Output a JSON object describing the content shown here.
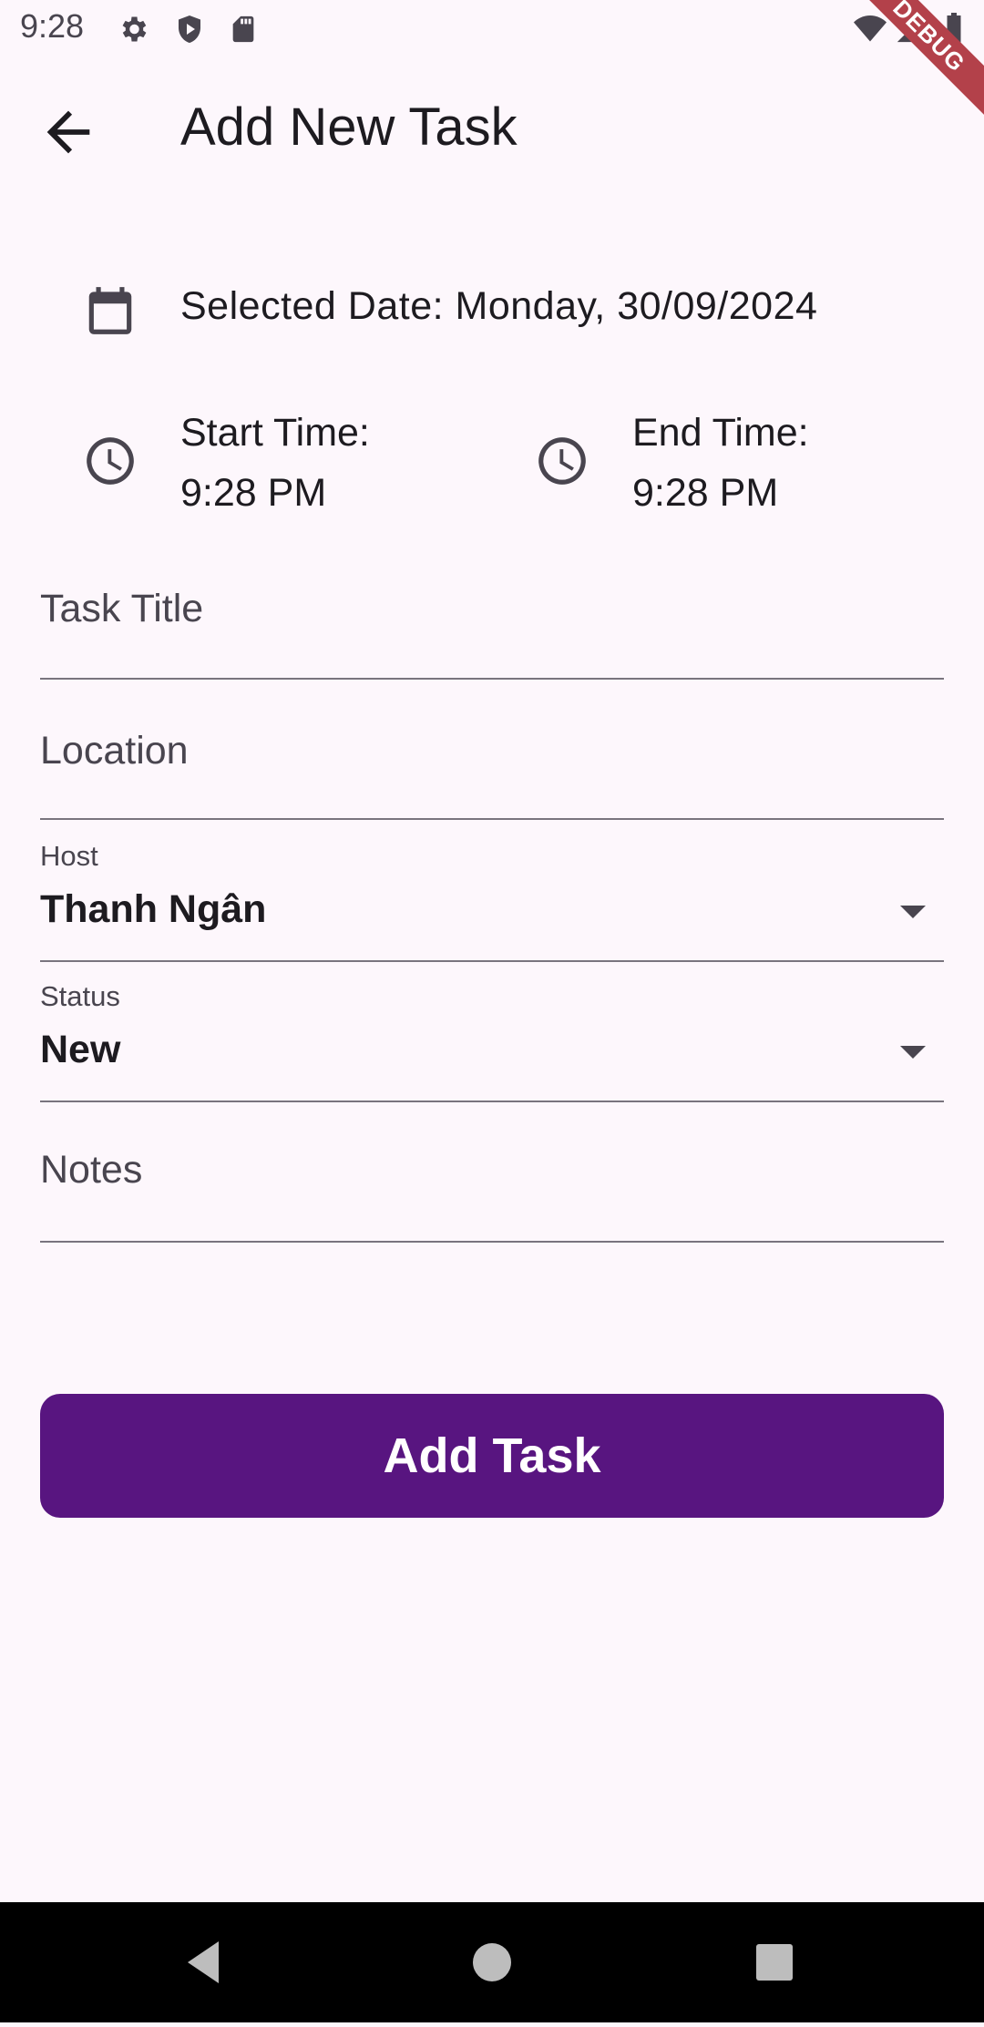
{
  "status_bar": {
    "time": "9:28",
    "icons": [
      "settings-icon",
      "shield-icon",
      "sd-card-icon",
      "wifi-icon",
      "signal-icon",
      "battery-icon"
    ],
    "debug_label": "DEBUG"
  },
  "app_bar": {
    "title": "Add New Task",
    "back_icon": "arrow-back-icon"
  },
  "date_row": {
    "icon": "calendar-icon",
    "text": "Selected Date: Monday, 30/09/2024"
  },
  "start_time": {
    "icon": "clock-icon",
    "label": "Start Time:",
    "value": "9:28 PM"
  },
  "end_time": {
    "icon": "clock-icon",
    "label": "End Time:",
    "value": "9:28 PM"
  },
  "form": {
    "task_title_placeholder": "Task Title",
    "location_placeholder": "Location",
    "host": {
      "label": "Host",
      "value": "Thanh Ngân"
    },
    "status": {
      "label": "Status",
      "value": "New"
    },
    "notes_placeholder": "Notes"
  },
  "submit": {
    "label": "Add Task"
  },
  "colors": {
    "background": "#FDF7FC",
    "primary_button": "#581580",
    "debug_banner": "#B3414A"
  },
  "nav_bar": {
    "icons": [
      "back-nav-icon",
      "home-nav-icon",
      "recents-nav-icon"
    ]
  }
}
